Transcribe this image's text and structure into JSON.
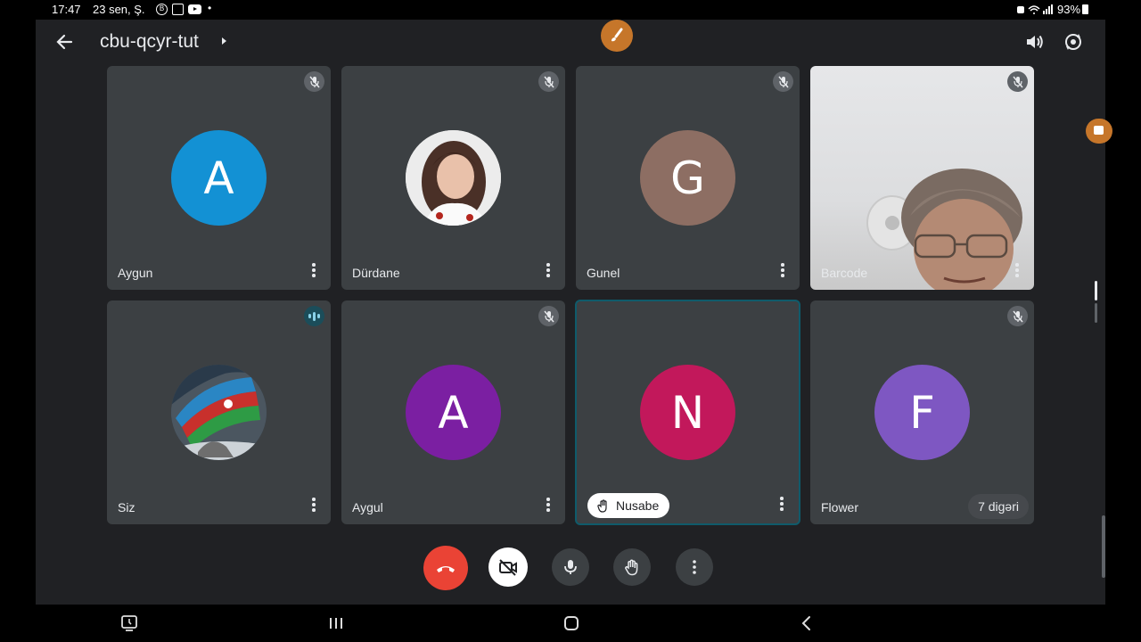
{
  "status_bar": {
    "time": "17:47",
    "date": "23 sen, Ş.",
    "battery": "93%"
  },
  "header": {
    "meeting_name": "cbu-qcyr-tut",
    "icons": [
      "back-icon",
      "brush-icon",
      "volume-icon",
      "switch-camera-icon"
    ]
  },
  "participants": [
    {
      "name": "Aygun",
      "initial": "A",
      "color": "#1391d4",
      "muted": true
    },
    {
      "name": "Dürdane",
      "initial": "",
      "color": "#d9c7bd",
      "muted": true
    },
    {
      "name": "Gunel",
      "initial": "G",
      "color": "#8d6e63",
      "muted": true
    },
    {
      "name": "Barcode",
      "initial": "",
      "color": "#d9dadc",
      "muted": true
    },
    {
      "name": "Siz",
      "initial": "",
      "color": "#3a4a5a",
      "muted": false
    },
    {
      "name": "Aygul",
      "initial": "A",
      "color": "#7b1fa2",
      "muted": true
    },
    {
      "name": "Nusabe",
      "initial": "N",
      "color": "#c2185b",
      "muted": false,
      "hand_raised": true
    },
    {
      "name": "Flower",
      "initial": "F",
      "color": "#7e57c2",
      "muted": true
    }
  ],
  "others_label": "7 digəri",
  "controls": [
    "end-call-icon",
    "camera-off-icon",
    "mic-icon",
    "raise-hand-icon",
    "more-options-icon"
  ],
  "colors": {
    "end_call": "#ea4335",
    "tile_background": "#3c4043",
    "app_background": "#202124",
    "accent_brush": "#c6762a"
  }
}
